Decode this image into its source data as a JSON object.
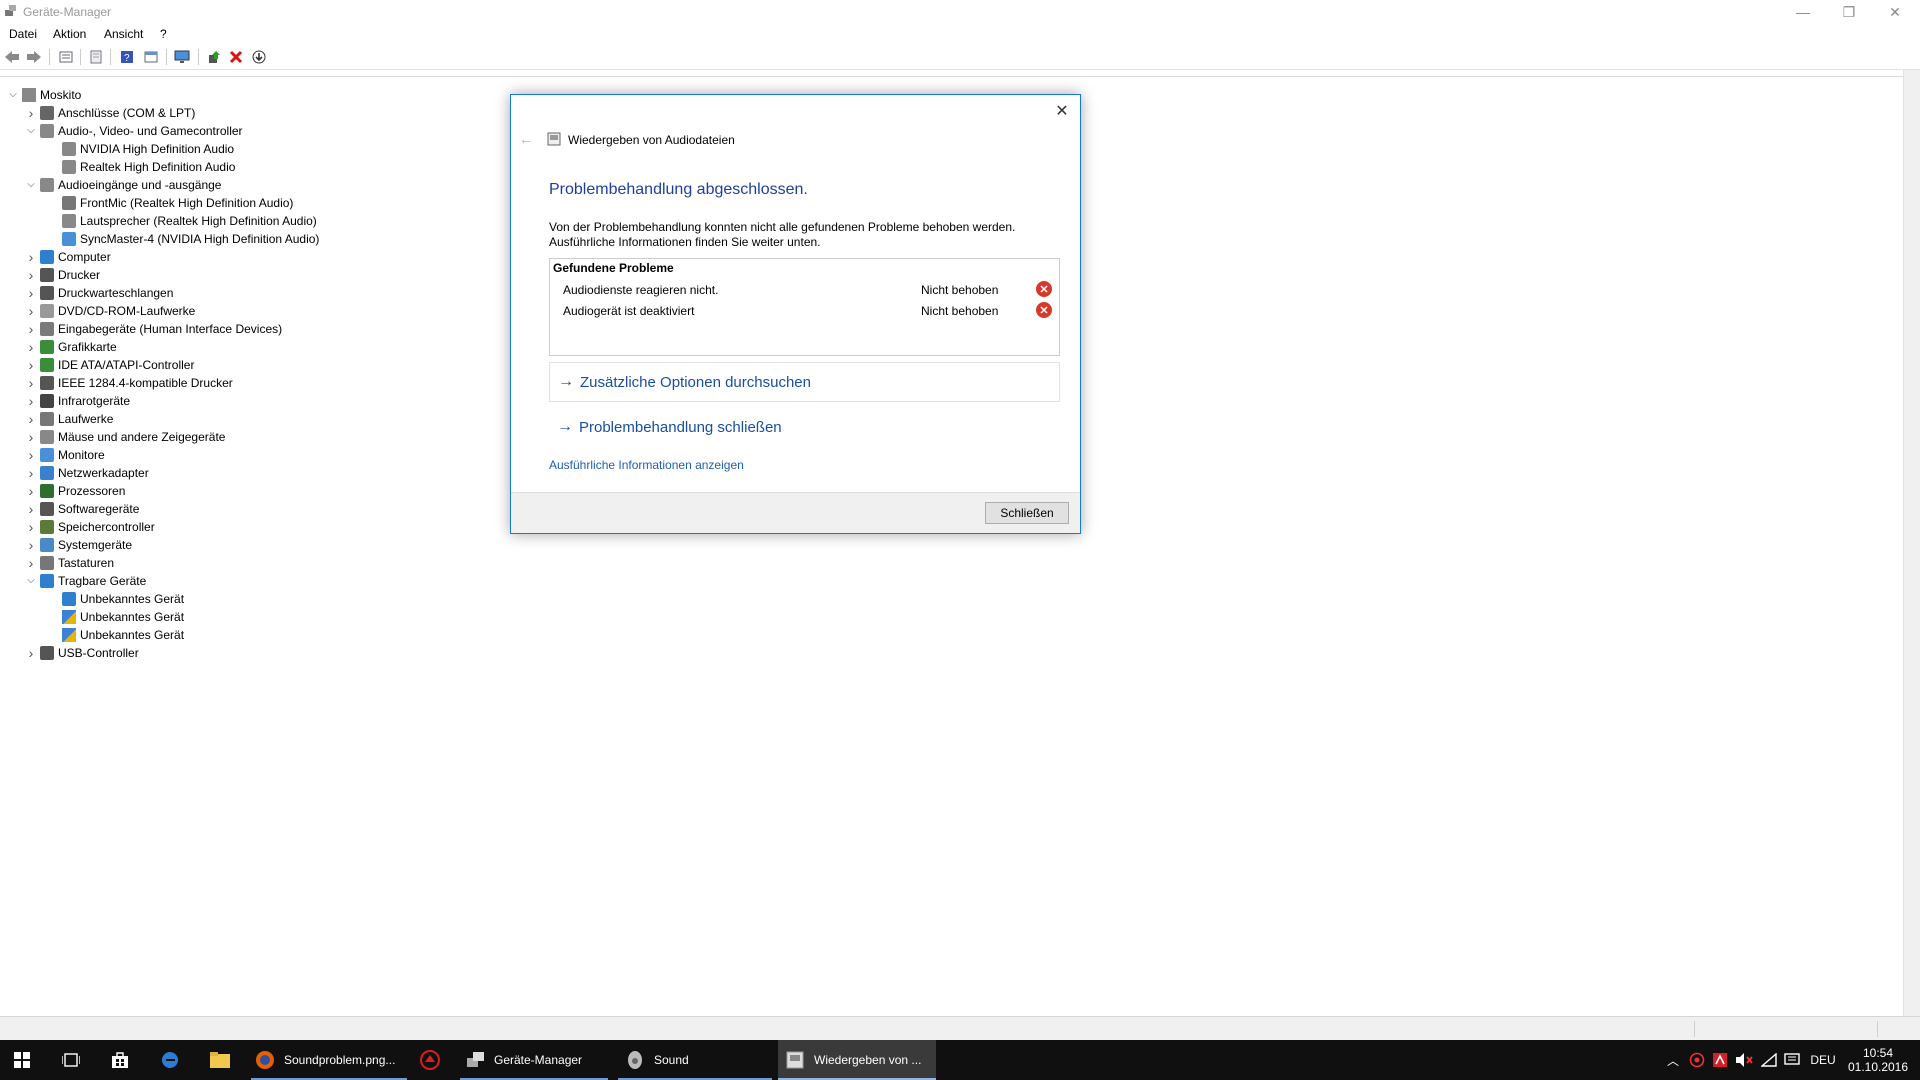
{
  "window": {
    "title": "Geräte-Manager",
    "controls": {
      "minimize": "—",
      "restore": "❐",
      "close": "✕"
    }
  },
  "menu": [
    "Datei",
    "Aktion",
    "Ansicht",
    "?"
  ],
  "toolbar_icons": [
    "back-icon",
    "forward-icon",
    "properties-icon",
    "show-hidden-icon",
    "help-icon",
    "details-icon",
    "monitor-icon",
    "update-driver-icon",
    "uninstall-icon",
    "scan-hardware-icon"
  ],
  "tree": {
    "root": "Moskito",
    "items": [
      {
        "label": "Anschlüsse (COM & LPT)",
        "level": 1,
        "expanded": false,
        "icon": "port-icon"
      },
      {
        "label": "Audio-, Video- und Gamecontroller",
        "level": 1,
        "expanded": true,
        "icon": "speaker-icon"
      },
      {
        "label": "NVIDIA High Definition Audio",
        "level": 2,
        "icon": "speaker-icon"
      },
      {
        "label": "Realtek High Definition Audio",
        "level": 2,
        "icon": "speaker-icon"
      },
      {
        "label": "Audioeingänge und -ausgänge",
        "level": 1,
        "expanded": true,
        "icon": "speaker-icon"
      },
      {
        "label": "FrontMic (Realtek High Definition Audio)",
        "level": 2,
        "icon": "microphone-icon"
      },
      {
        "label": "Lautsprecher (Realtek High Definition Audio)",
        "level": 2,
        "icon": "speaker-icon"
      },
      {
        "label": "SyncMaster-4 (NVIDIA High Definition Audio)",
        "level": 2,
        "icon": "monitor-icon"
      },
      {
        "label": "Computer",
        "level": 1,
        "expanded": false,
        "icon": "computer-icon"
      },
      {
        "label": "Drucker",
        "level": 1,
        "expanded": false,
        "icon": "printer-icon"
      },
      {
        "label": "Druckwarteschlangen",
        "level": 1,
        "expanded": false,
        "icon": "printer-icon"
      },
      {
        "label": "DVD/CD-ROM-Laufwerke",
        "level": 1,
        "expanded": false,
        "icon": "disc-icon"
      },
      {
        "label": "Eingabegeräte (Human Interface Devices)",
        "level": 1,
        "expanded": false,
        "icon": "hid-icon"
      },
      {
        "label": "Grafikkarte",
        "level": 1,
        "expanded": false,
        "icon": "display-adapter-icon"
      },
      {
        "label": "IDE ATA/ATAPI-Controller",
        "level": 1,
        "expanded": false,
        "icon": "controller-icon"
      },
      {
        "label": "IEEE 1284.4-kompatible Drucker",
        "level": 1,
        "expanded": false,
        "icon": "printer-icon"
      },
      {
        "label": "Infrarotgeräte",
        "level": 1,
        "expanded": false,
        "icon": "infrared-icon"
      },
      {
        "label": "Laufwerke",
        "level": 1,
        "expanded": false,
        "icon": "drive-icon"
      },
      {
        "label": "Mäuse und andere Zeigegeräte",
        "level": 1,
        "expanded": false,
        "icon": "mouse-icon"
      },
      {
        "label": "Monitore",
        "level": 1,
        "expanded": false,
        "icon": "monitor-icon"
      },
      {
        "label": "Netzwerkadapter",
        "level": 1,
        "expanded": false,
        "icon": "network-icon"
      },
      {
        "label": "Prozessoren",
        "level": 1,
        "expanded": false,
        "icon": "processor-icon"
      },
      {
        "label": "Softwaregeräte",
        "level": 1,
        "expanded": false,
        "icon": "software-device-icon"
      },
      {
        "label": "Speichercontroller",
        "level": 1,
        "expanded": false,
        "icon": "storage-controller-icon"
      },
      {
        "label": "Systemgeräte",
        "level": 1,
        "expanded": false,
        "icon": "system-icon"
      },
      {
        "label": "Tastaturen",
        "level": 1,
        "expanded": false,
        "icon": "keyboard-icon"
      },
      {
        "label": "Tragbare Geräte",
        "level": 1,
        "expanded": true,
        "icon": "portable-device-icon"
      },
      {
        "label": "Unbekanntes Gerät",
        "level": 2,
        "icon": "portable-device-icon"
      },
      {
        "label": "Unbekanntes Gerät",
        "level": 2,
        "icon": "warning-icon"
      },
      {
        "label": "Unbekanntes Gerät",
        "level": 2,
        "icon": "warning-icon"
      },
      {
        "label": "USB-Controller",
        "level": 1,
        "expanded": false,
        "icon": "usb-icon"
      }
    ]
  },
  "dialog": {
    "title": "Wiedergeben von Audiodateien",
    "heading": "Problembehandlung abgeschlossen.",
    "description_line1": "Von der Problembehandlung konnten nicht alle gefundenen Probleme behoben werden.",
    "description_line2": "Ausführliche Informationen finden Sie weiter unten.",
    "problems_header": "Gefundene Probleme",
    "problems": [
      {
        "name": "Audiodienste reagieren nicht.",
        "status": "Nicht behoben"
      },
      {
        "name": "Audiogerät ist deaktiviert",
        "status": "Nicht behoben"
      }
    ],
    "option_more": "Zusätzliche Optionen durchsuchen",
    "option_close": "Problembehandlung schließen",
    "details_link": "Ausführliche Informationen anzeigen",
    "close_button": "Schließen"
  },
  "taskbar": {
    "buttons": [
      {
        "label": "Soundproblem.png...",
        "icon": "firefox-icon"
      },
      {
        "label": "Geräte-Manager",
        "icon": "device-manager-icon"
      },
      {
        "label": "Sound",
        "icon": "sound-icon"
      },
      {
        "label": "Wiedergeben von ...",
        "icon": "troubleshooter-icon"
      }
    ],
    "language": "DEU",
    "time": "10:54",
    "date": "01.10.2016"
  },
  "colors": {
    "accent": "#1979ca",
    "heading": "#1e3f9c",
    "link": "#1a4fa0",
    "error": "#d6392b",
    "taskbar": "#101010"
  }
}
